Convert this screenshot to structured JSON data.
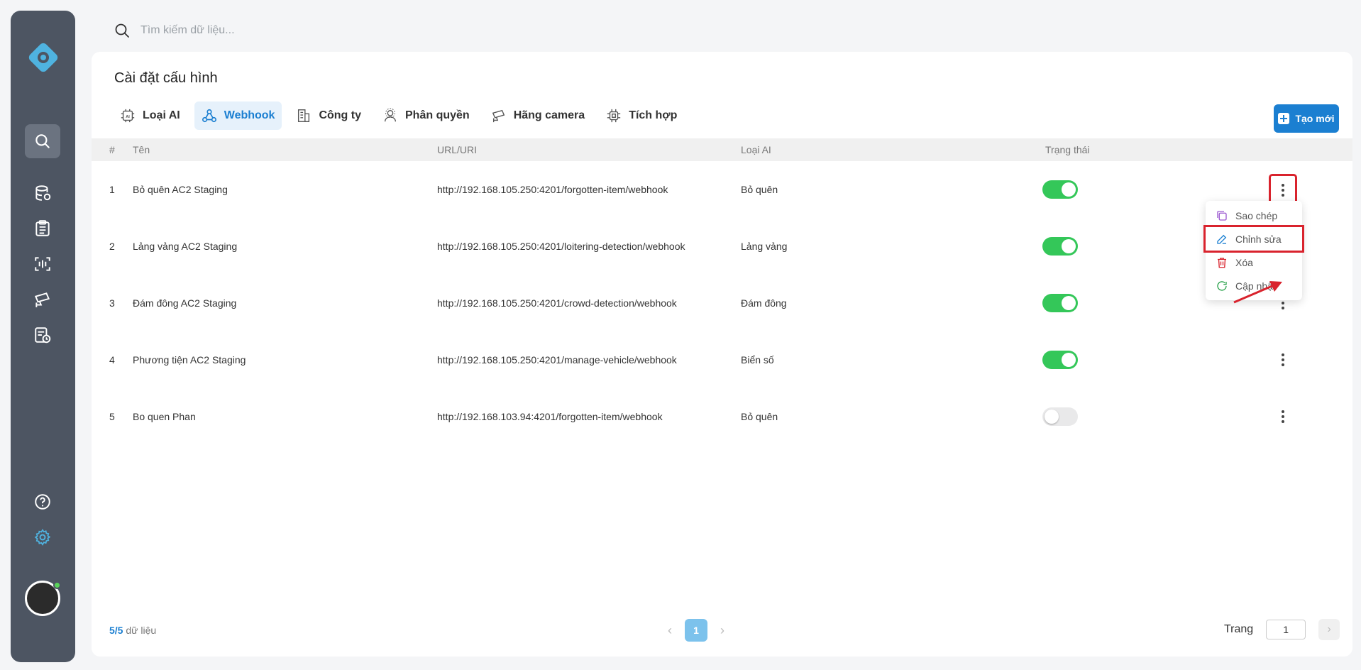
{
  "search": {
    "placeholder": "Tìm kiếm dữ liệu..."
  },
  "page": {
    "title": "Cài đặt cấu hình"
  },
  "tabs": [
    {
      "label": "Loại AI",
      "icon": "ai-chip-icon"
    },
    {
      "label": "Webhook",
      "icon": "webhook-icon",
      "active": true
    },
    {
      "label": "Công ty",
      "icon": "building-icon"
    },
    {
      "label": "Phân quyền",
      "icon": "user-settings-icon"
    },
    {
      "label": "Hãng camera",
      "icon": "cctv-camera-icon"
    },
    {
      "label": "Tích hợp",
      "icon": "cpu-icon"
    }
  ],
  "create_button": {
    "label": "Tạo mới"
  },
  "table": {
    "columns": [
      "#",
      "Tên",
      "URL/URI",
      "Loại AI",
      "Trạng thái"
    ],
    "rows": [
      {
        "index": "1",
        "name": "Bỏ quên AC2 Staging",
        "url": "http://192.168.105.250:4201/forgotten-item/webhook",
        "ai_type": "Bỏ quên",
        "enabled": true
      },
      {
        "index": "2",
        "name": "Lảng vảng AC2 Staging",
        "url": "http://192.168.105.250:4201/loitering-detection/webhook",
        "ai_type": "Lảng vảng",
        "enabled": true
      },
      {
        "index": "3",
        "name": "Đám đông AC2 Staging",
        "url": "http://192.168.105.250:4201/crowd-detection/webhook",
        "ai_type": "Đám đông",
        "enabled": true
      },
      {
        "index": "4",
        "name": "Phương tiện AC2 Staging",
        "url": "http://192.168.105.250:4201/manage-vehicle/webhook",
        "ai_type": "Biển số",
        "enabled": true
      },
      {
        "index": "5",
        "name": "Bo quen Phan",
        "url": "http://192.168.103.94:4201/forgotten-item/webhook",
        "ai_type": "Bỏ quên",
        "enabled": false
      }
    ]
  },
  "row_menu": {
    "items": [
      {
        "label": "Sao chép",
        "icon": "copy-icon",
        "color": "#9b59d0"
      },
      {
        "label": "Chỉnh sửa",
        "icon": "edit-icon",
        "color": "#1b7fd1"
      },
      {
        "label": "Xóa",
        "icon": "trash-icon",
        "color": "#d9232d"
      },
      {
        "label": "Cập nhật",
        "icon": "refresh-icon",
        "color": "#2ea44f"
      }
    ]
  },
  "footer": {
    "count_shown": "5",
    "count_total": "/5",
    "count_suffix": " dữ liệu",
    "current_page": "1",
    "goto_label": "Trang",
    "goto_value": "1"
  },
  "colors": {
    "accent": "#1b7fd1",
    "sidebar": "#4d5562",
    "toggle_on": "#34c759",
    "highlight": "#d9232d"
  }
}
